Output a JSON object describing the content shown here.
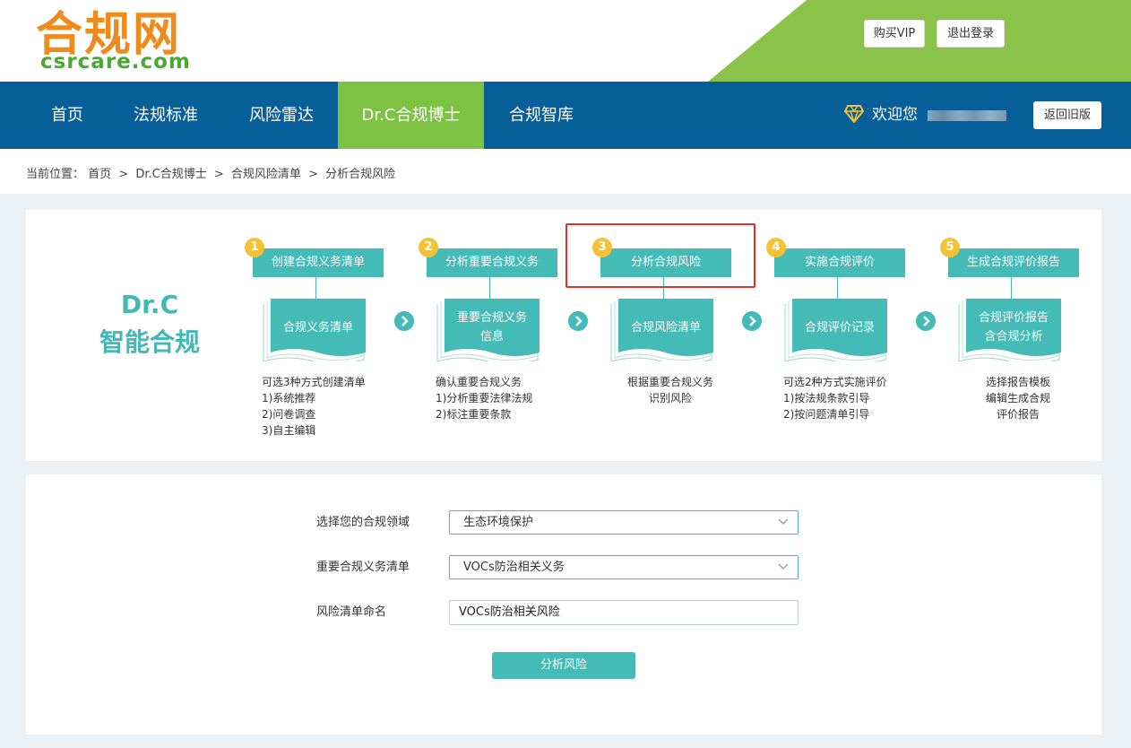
{
  "header": {
    "logo_cn": "合规网",
    "logo_en": "csrcare.com",
    "buy_vip": "购买VIP",
    "logout": "退出登录"
  },
  "nav": {
    "items": [
      {
        "label": "首页"
      },
      {
        "label": "法规标准"
      },
      {
        "label": "风险雷达"
      },
      {
        "label": "Dr.C合规博士"
      },
      {
        "label": "合规智库"
      }
    ],
    "welcome": "欢迎您",
    "old_version": "返回旧版"
  },
  "breadcrumb": {
    "prefix": "当前位置：",
    "items": [
      "首页",
      "Dr.C合规博士",
      "合规风险清单",
      "分析合规风险"
    ],
    "separator": ">"
  },
  "intro": {
    "line1": "Dr.C",
    "line2": "智能合规"
  },
  "steps": [
    {
      "num": "1",
      "title": "创建合规义务清单",
      "doc": [
        "合规义务清单"
      ],
      "desc": [
        "可选3种方式创建清单",
        "1)系统推荐",
        "2)问卷调查",
        "3)自主编辑"
      ]
    },
    {
      "num": "2",
      "title": "分析重要合规义务",
      "doc": [
        "重要合规义务",
        "信息"
      ],
      "desc": [
        "确认重要合规义务",
        "1)分析重要法律法规",
        "2)标注重要条款"
      ]
    },
    {
      "num": "3",
      "title": "分析合规风险",
      "doc": [
        "合规风险清单"
      ],
      "desc": [
        "根据重要合规义务",
        "识别风险"
      ]
    },
    {
      "num": "4",
      "title": "实施合规评价",
      "doc": [
        "合规评价记录"
      ],
      "desc": [
        "可选2种方式实施评价",
        "1)按法规条款引导",
        "2)按问题清单引导"
      ]
    },
    {
      "num": "5",
      "title": "生成合规评价报告",
      "doc": [
        "合规评价报告",
        "含合规分析"
      ],
      "desc": [
        "选择报告模板",
        "编辑生成合规",
        "评价报告"
      ]
    }
  ],
  "form": {
    "domain_label": "选择您的合规领域",
    "domain_value": "生态环境保护",
    "obligation_label": "重要合规义务清单",
    "obligation_value": "VOCs防治相关义务",
    "name_label": "风险清单命名",
    "name_value": "VOCs防治相关风险",
    "submit": "分析风险"
  },
  "colors": {
    "nav_bg": "#075f9a",
    "nav_active": "#7dc242",
    "teal": "#44bbb7",
    "logo_orange": "#f08a1c",
    "logo_green": "#49a933",
    "highlight_red": "#e3322b"
  }
}
